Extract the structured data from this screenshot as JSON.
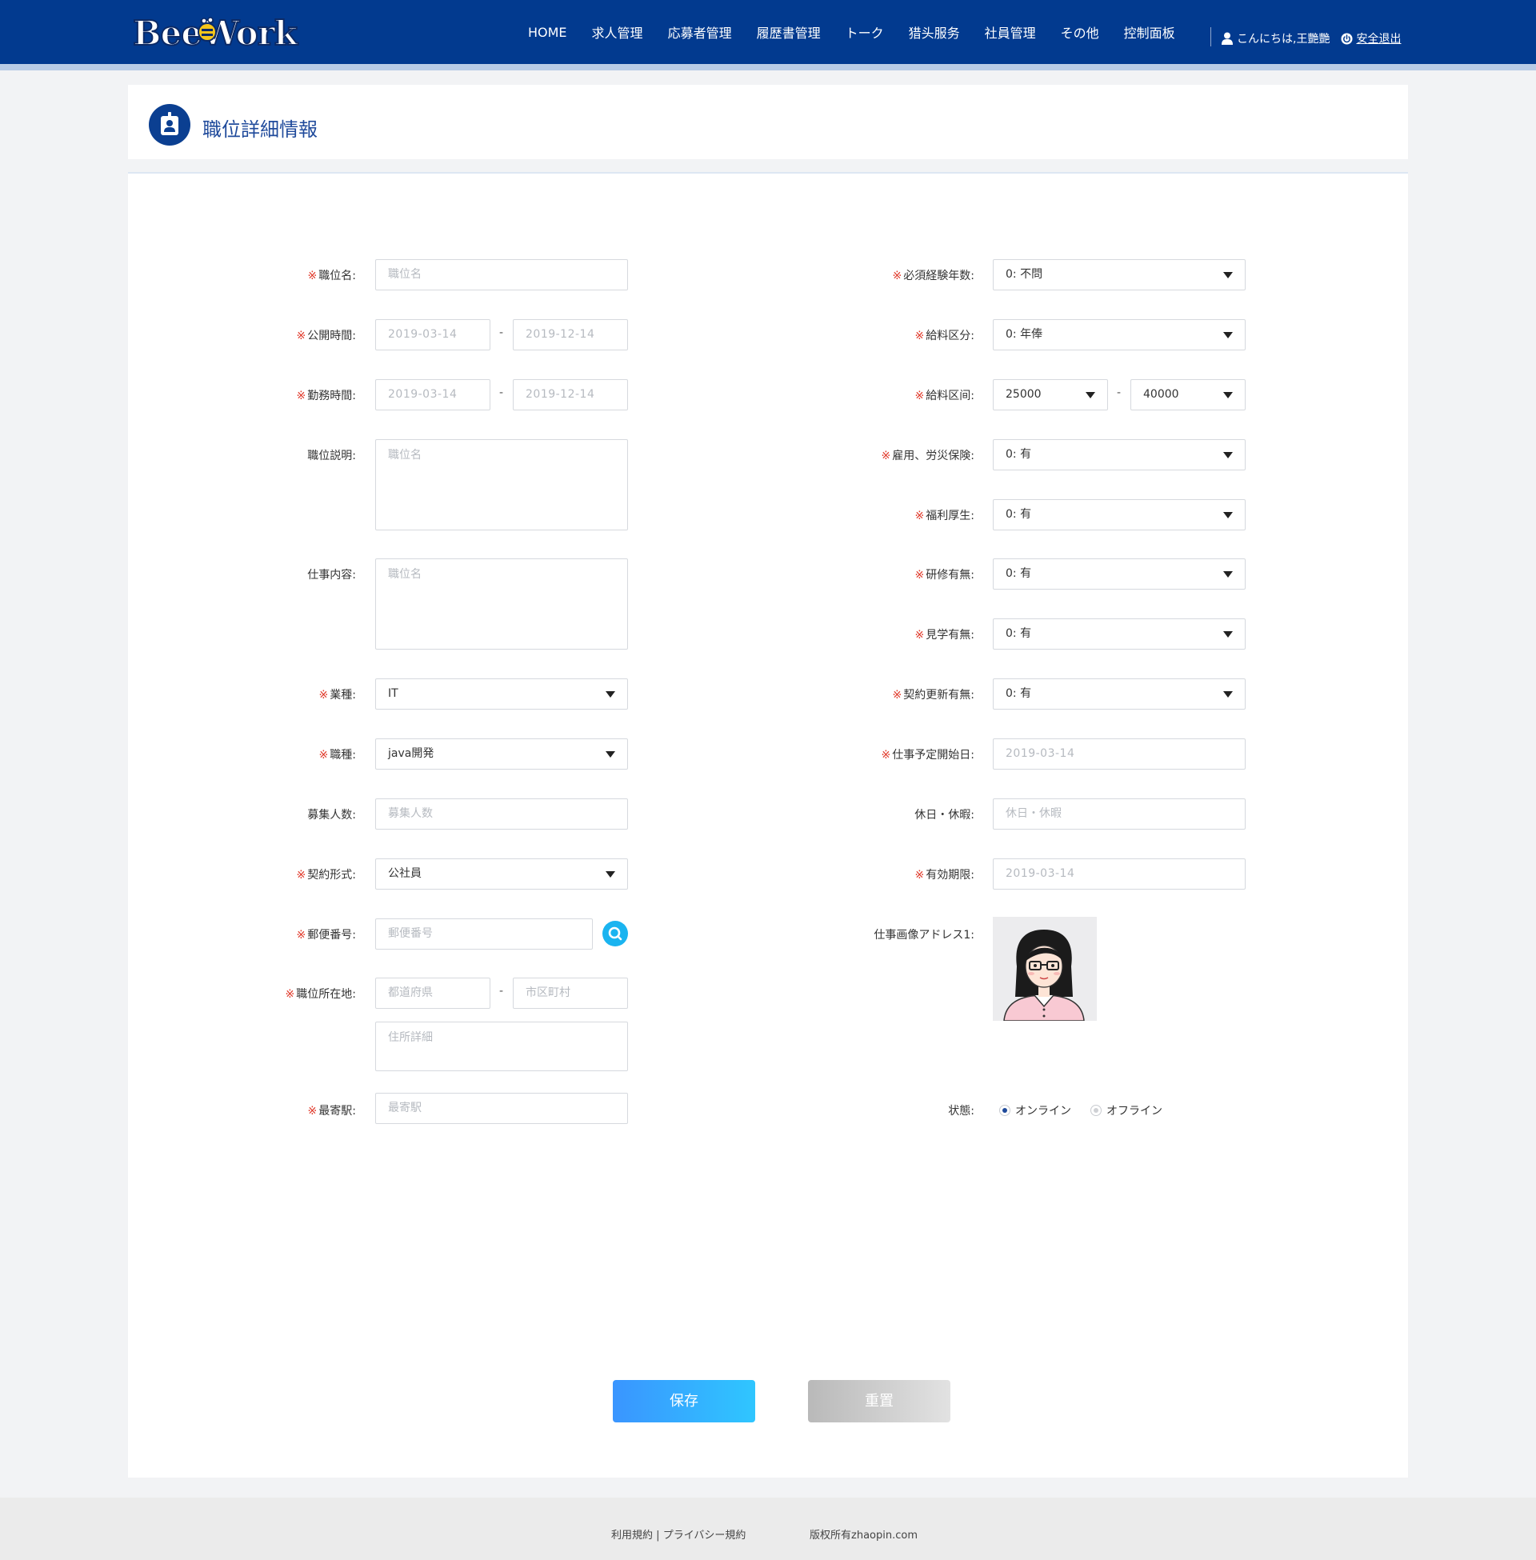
{
  "header": {
    "logo_text": "BeeWork",
    "nav": [
      "HOME",
      "求人管理",
      "応募者管理",
      "履歴書管理",
      "トーク",
      "猎头服务",
      "社員管理",
      "その他",
      "控制面板"
    ],
    "greeting": "こんにちは,王艷艷",
    "logout": "安全退出"
  },
  "page": {
    "title": "職位詳細情報"
  },
  "form": {
    "required_mark": "※",
    "left": {
      "job_name": {
        "label": "職位名:",
        "placeholder": "職位名"
      },
      "publish_time": {
        "label": "公開時間:",
        "start": "2019-03-14",
        "end": "2019-12-14"
      },
      "work_time": {
        "label": "勤務時間:",
        "start": "2019-03-14",
        "end": "2019-12-14"
      },
      "job_description": {
        "label": "職位説明:",
        "placeholder": "職位名"
      },
      "job_content": {
        "label": "仕事内容:",
        "placeholder": "職位名"
      },
      "industry": {
        "label": "業種:",
        "value": "IT"
      },
      "occupation": {
        "label": "職種:",
        "value": "java開発"
      },
      "recruit_count": {
        "label": "募集人数:",
        "placeholder": "募集人数"
      },
      "contract_type": {
        "label": "契約形式:",
        "value": "公社員"
      },
      "postal_code": {
        "label": "郵便番号:",
        "placeholder": "郵便番号"
      },
      "location": {
        "label": "職位所在地:",
        "prefecture": "都道府県",
        "city": "市区町村",
        "detail": "住所詳細"
      },
      "nearest_station": {
        "label": "最寄駅:",
        "placeholder": "最寄駅"
      },
      "range_sep": "-"
    },
    "right": {
      "experience": {
        "label": "必須経験年数:",
        "value": "0: 不問"
      },
      "salary_type": {
        "label": "給料区分:",
        "value": "0: 年俸"
      },
      "salary_range": {
        "label": "給料区间:",
        "min": "25000",
        "max": "40000"
      },
      "insurance": {
        "label": "雇用、労災保険:",
        "value": "0: 有"
      },
      "welfare": {
        "label": "福利厚生:",
        "value": "0: 有"
      },
      "training": {
        "label": "研修有無:",
        "value": "0: 有"
      },
      "tour": {
        "label": "見学有無:",
        "value": "0: 有"
      },
      "renewal": {
        "label": "契約更新有無:",
        "value": "0: 有"
      },
      "start_date": {
        "label": "仕事予定開始日:",
        "value": "2019-03-14"
      },
      "holidays": {
        "label": "休日・休暇:",
        "placeholder": "休日・休暇"
      },
      "expiry": {
        "label": "有効期限:",
        "value": "2019-03-14"
      },
      "image": {
        "label": "仕事画像アドレス1:"
      },
      "status": {
        "label": "状態:",
        "options": [
          "オンライン",
          "オフライン"
        ],
        "selected": "オンライン"
      }
    },
    "buttons": {
      "save": "保存",
      "reset": "重置"
    }
  },
  "footer": {
    "terms": "利用規約",
    "sep": "|",
    "privacy": "プライバシー規約",
    "copyright": "版权所有zhaopin.com"
  },
  "colors": {
    "header_bg": "#023a8f",
    "title": "#1f4a9b",
    "required": "#e03b2c",
    "save_button": "#2fa8ff",
    "search_button": "#1ab4f0"
  }
}
